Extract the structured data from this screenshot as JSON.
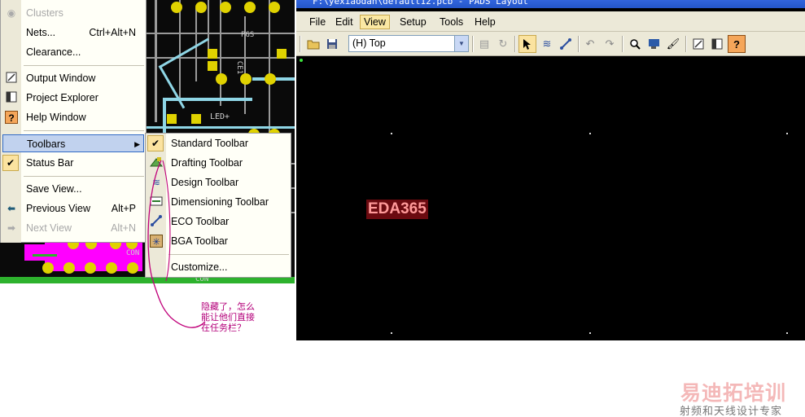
{
  "window": {
    "title": "F:\\yexiaodan\\default12.pcb - PADS Layout"
  },
  "menubar": {
    "items": [
      "File",
      "Edit",
      "View",
      "Setup",
      "Tools",
      "Help"
    ],
    "active": "View"
  },
  "toolbar": {
    "layer_value": "(H) Top",
    "buttons": [
      "open-folder-icon",
      "save-icon",
      "properties-icon",
      "refresh-icon",
      "select-arrow-icon",
      "design-toolbar-icon",
      "routing-icon",
      "undo-icon",
      "redo-icon",
      "zoom-icon",
      "verify-icon",
      "paint-brush-icon",
      "output-window-icon",
      "project-explorer-icon",
      "help-icon"
    ]
  },
  "view_menu": {
    "items": [
      {
        "label": "Clusters",
        "accel": "",
        "enabled": false,
        "icon": "clusters-icon"
      },
      {
        "label": "Nets...",
        "accel": "Ctrl+Alt+N",
        "enabled": true
      },
      {
        "label": "Clearance...",
        "accel": "",
        "enabled": true
      },
      {
        "label": "Output Window",
        "accel": "",
        "enabled": true,
        "icon": "output-window-icon"
      },
      {
        "label": "Project Explorer",
        "accel": "",
        "enabled": true,
        "icon": "project-explorer-icon"
      },
      {
        "label": "Help Window",
        "accel": "",
        "enabled": true,
        "icon": "help-icon"
      },
      {
        "label": "Toolbars",
        "accel": "",
        "enabled": true,
        "highlighted": true,
        "submenu": true
      },
      {
        "label": "Status Bar",
        "accel": "",
        "enabled": true,
        "checked": true
      },
      {
        "label": "Save View...",
        "accel": "",
        "enabled": true
      },
      {
        "label": "Previous View",
        "accel": "Alt+P",
        "enabled": true,
        "icon": "back-arrow-icon"
      },
      {
        "label": "Next View",
        "accel": "Alt+N",
        "enabled": false,
        "icon": "forward-arrow-icon"
      }
    ]
  },
  "toolbars_menu": {
    "items": [
      {
        "label": "Standard Toolbar",
        "checked": true
      },
      {
        "label": "Drafting Toolbar",
        "icon": "drafting-icon"
      },
      {
        "label": "Design Toolbar",
        "icon": "design-icon"
      },
      {
        "label": "Dimensioning Toolbar",
        "icon": "dimensioning-icon"
      },
      {
        "label": "ECO Toolbar",
        "icon": "eco-icon"
      },
      {
        "label": "BGA Toolbar",
        "icon": "bga-icon"
      },
      {
        "label": "Customize..."
      }
    ]
  },
  "canvas": {
    "label": "EDA365"
  },
  "annotation": {
    "line1": "隐藏了，怎么",
    "line2": "能让他们直接",
    "line3": "在任务栏？"
  },
  "watermark": {
    "logo": "易迪拓培训",
    "subtitle": "射频和天线设计专家"
  },
  "pcb_text": {
    "t1": "PGS",
    "t2": "CE1",
    "t3": "LED+",
    "t4": "CON",
    "t5": "CON"
  },
  "colors": {
    "menu_bg": "#fffff7",
    "highlight": "#c1d2ee",
    "titlebar": "#2456c9",
    "canvas": "#000000"
  }
}
